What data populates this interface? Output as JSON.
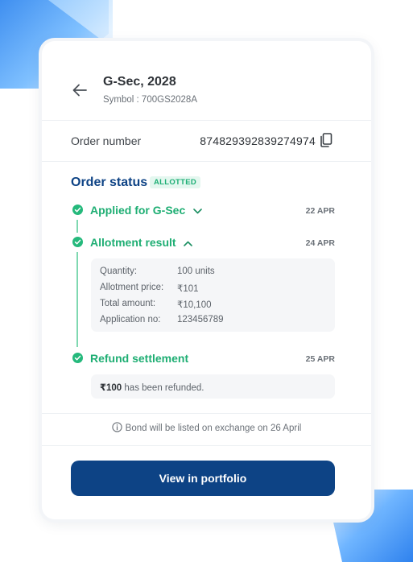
{
  "header": {
    "title": "G-Sec, 2028",
    "subtitle": "Symbol : 700GS2028A"
  },
  "order": {
    "label": "Order number",
    "number": "874829392839274974"
  },
  "status": {
    "title": "Order status",
    "badge": "ALLOTTED",
    "steps": [
      {
        "label": "Applied for G-Sec",
        "date": "22 APR",
        "expanded": false
      },
      {
        "label": "Allotment result",
        "date": "24 APR",
        "expanded": true
      },
      {
        "label": "Refund settlement",
        "date": "25 APR"
      }
    ],
    "allotment_details": [
      {
        "key": "Quantity:",
        "value": "100 units"
      },
      {
        "key": "Allotment price:",
        "value": "₹101"
      },
      {
        "key": "Total amount:",
        "value": "₹10,100"
      },
      {
        "key": "Application no:",
        "value": "123456789"
      }
    ],
    "refund": {
      "amount": "₹100",
      "text": " has been refunded."
    }
  },
  "info_note": "Bond will be listed on exchange on 26 April",
  "cta_label": "View in portfolio",
  "colors": {
    "primary": "#0d4385",
    "success": "#25b97c",
    "badge_bg": "#e4f7ef"
  },
  "icons": [
    "back-arrow-icon",
    "copy-icon",
    "check-icon",
    "chevron-down-icon",
    "chevron-up-icon",
    "info-icon"
  ]
}
